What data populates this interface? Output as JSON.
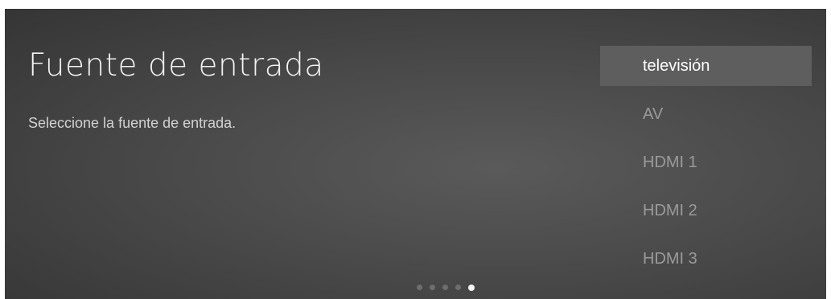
{
  "header": {
    "title": "Fuente de entrada",
    "subtitle": "Seleccione la fuente de entrada."
  },
  "sources": {
    "selected_index": 0,
    "items": [
      {
        "label": "televisión"
      },
      {
        "label": "AV"
      },
      {
        "label": "HDMI 1"
      },
      {
        "label": "HDMI 2"
      },
      {
        "label": "HDMI 3"
      }
    ]
  },
  "pager": {
    "total_pages": 5,
    "current_page": 5
  },
  "colors": {
    "background": "#4a4a4a",
    "selected_row": "#5e5e5e",
    "text_primary": "#f2f2f2",
    "text_muted": "#9a9a9a"
  }
}
